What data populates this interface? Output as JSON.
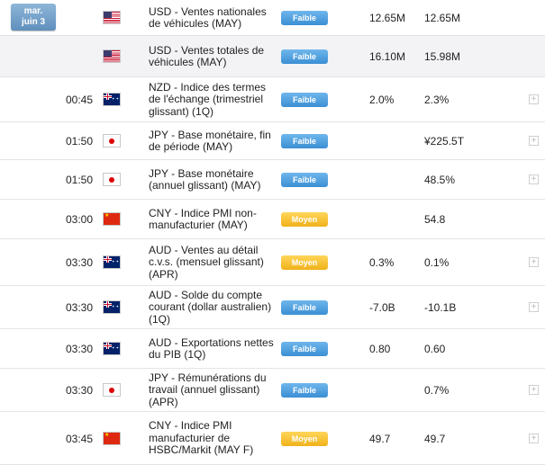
{
  "date_badge": {
    "line1": "mar.",
    "line2": "juin 3"
  },
  "rows": [
    {
      "time": "",
      "flag": "us-flag-icon",
      "event": "USD - Ventes nationales de véhicules (MAY)",
      "importance": "Faible",
      "actual": "12.65M",
      "forecast": "12.65M",
      "expand": ""
    },
    {
      "time": "",
      "flag": "us-flag-icon",
      "event": "USD - Ventes totales de véhicules (MAY)",
      "importance": "Faible",
      "actual": "16.10M",
      "forecast": "15.98M",
      "expand": ""
    },
    {
      "time": "00:45",
      "flag": "au-flag-icon",
      "event": "NZD - Indice des termes de l'échange (trimestriel glissant) (1Q)",
      "importance": "Faible",
      "actual": "2.0%",
      "forecast": "2.3%",
      "expand": "+"
    },
    {
      "time": "01:50",
      "flag": "jp-flag-icon",
      "event": "JPY - Base monétaire, fin de période (MAY)",
      "importance": "Faible",
      "actual": "",
      "forecast": "¥225.5T",
      "expand": "+"
    },
    {
      "time": "01:50",
      "flag": "jp-flag-icon",
      "event": "JPY - Base monétaire (annuel glissant) (MAY)",
      "importance": "Faible",
      "actual": "",
      "forecast": "48.5%",
      "expand": "+"
    },
    {
      "time": "03:00",
      "flag": "cn-flag-icon",
      "event": "CNY - Indice PMI non-manufacturier (MAY)",
      "importance": "Moyen",
      "actual": "",
      "forecast": "54.8",
      "expand": ""
    },
    {
      "time": "03:30",
      "flag": "au-flag-icon",
      "event": "AUD - Ventes au détail c.v.s. (mensuel glissant) (APR)",
      "importance": "Moyen",
      "actual": "0.3%",
      "forecast": "0.1%",
      "expand": "+"
    },
    {
      "time": "03:30",
      "flag": "au-flag-icon",
      "event": "AUD - Solde du compte courant (dollar australien) (1Q)",
      "importance": "Faible",
      "actual": "-7.0B",
      "forecast": "-10.1B",
      "expand": "+"
    },
    {
      "time": "03:30",
      "flag": "au-flag-icon",
      "event": "AUD - Exportations nettes du PIB (1Q)",
      "importance": "Faible",
      "actual": "0.80",
      "forecast": "0.60",
      "expand": ""
    },
    {
      "time": "03:30",
      "flag": "jp-flag-icon",
      "event": "JPY - Rémunérations du travail (annuel glissant) (APR)",
      "importance": "Faible",
      "actual": "",
      "forecast": "0.7%",
      "expand": "+"
    },
    {
      "time": "03:45",
      "flag": "cn-flag-icon",
      "event": "CNY - Indice PMI manufacturier de HSBC/Markit (MAY F)",
      "importance": "Moyen",
      "actual": "49.7",
      "forecast": "49.7",
      "expand": "+"
    }
  ]
}
